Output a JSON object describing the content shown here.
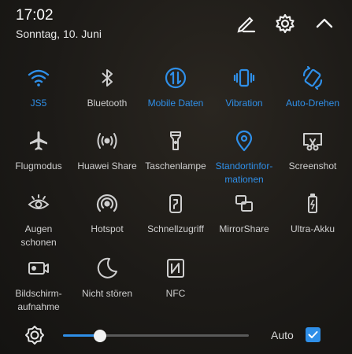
{
  "header": {
    "time": "17:02",
    "date": "Sonntag, 10. Juni",
    "icons": [
      "edit-icon",
      "settings-icon",
      "collapse-icon"
    ]
  },
  "colors": {
    "accent": "#2f8fe8",
    "inactive": "#cfcfcf",
    "background": "#1c1a17"
  },
  "tiles": [
    {
      "label": "JS5",
      "icon": "wifi-icon",
      "active": true
    },
    {
      "label": "Bluetooth",
      "icon": "bluetooth-icon",
      "active": false
    },
    {
      "label": "Mobile Daten",
      "icon": "mobile-data-icon",
      "active": true
    },
    {
      "label": "Vibration",
      "icon": "vibration-icon",
      "active": true
    },
    {
      "label": "Auto-Drehen",
      "icon": "auto-rotate-icon",
      "active": true
    },
    {
      "label": "Flugmodus",
      "icon": "airplane-icon",
      "active": false
    },
    {
      "label": "Huawei Share",
      "icon": "huawei-share-icon",
      "active": false
    },
    {
      "label": "Taschenlampe",
      "icon": "flashlight-icon",
      "active": false
    },
    {
      "label": "Standortinfor-\nmationen",
      "icon": "location-icon",
      "active": true
    },
    {
      "label": "Screenshot",
      "icon": "screenshot-icon",
      "active": false
    },
    {
      "label": "Augen\nschonen",
      "icon": "eye-comfort-icon",
      "active": false
    },
    {
      "label": "Hotspot",
      "icon": "hotspot-icon",
      "active": false
    },
    {
      "label": "Schnellzugriff",
      "icon": "quick-access-icon",
      "active": false
    },
    {
      "label": "MirrorShare",
      "icon": "mirrorshare-icon",
      "active": false
    },
    {
      "label": "Ultra-Akku",
      "icon": "ultra-battery-icon",
      "active": false
    },
    {
      "label": "Bildschirm-\naufnahme",
      "icon": "screen-record-icon",
      "active": false
    },
    {
      "label": "Nicht stören",
      "icon": "do-not-disturb-icon",
      "active": false
    },
    {
      "label": "NFC",
      "icon": "nfc-icon",
      "active": false
    }
  ],
  "brightness": {
    "icon": "brightness-icon",
    "level": 0.2,
    "auto_label": "Auto",
    "auto_checked": true
  }
}
